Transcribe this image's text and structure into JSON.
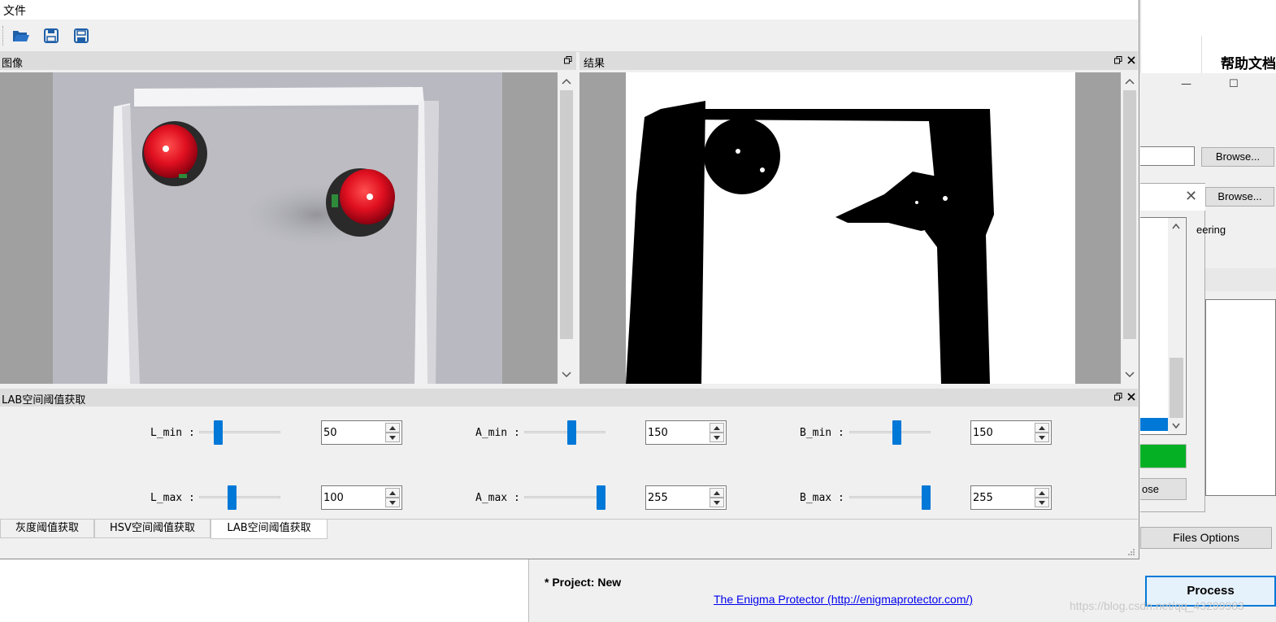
{
  "menu": {
    "file": "文件"
  },
  "toolbar": {
    "open_icon": "folder-open-icon",
    "save_icon": "save-icon",
    "save_as_icon": "save-as-icon"
  },
  "image_dock": {
    "title": "图像"
  },
  "result_dock": {
    "title": "结果"
  },
  "lab_dock": {
    "title": "LAB空间阈值获取"
  },
  "lab_params": {
    "l_min": {
      "label": "L_min :",
      "value": "50",
      "level": 0.2
    },
    "a_min": {
      "label": "A_min :",
      "value": "150",
      "level": 0.59
    },
    "b_min": {
      "label": "B_min :",
      "value": "150",
      "level": 0.59
    },
    "l_max": {
      "label": "L_max :",
      "value": "100",
      "level": 0.39
    },
    "a_max": {
      "label": "A_max :",
      "value": "255",
      "level": 1.0
    },
    "b_max": {
      "label": "B_max :",
      "value": "255",
      "level": 1.0
    }
  },
  "tabs": [
    "灰度阈值获取",
    "HSV空间阈值获取",
    "LAB空间阈值获取"
  ],
  "active_tab": 2,
  "background_app": {
    "help_title": "帮助文档",
    "browse_1": "Browse...",
    "browse_2": "Browse...",
    "steering_text": "eering",
    "close_button": "ose",
    "files_options": "Files Options",
    "process": "Process",
    "project": "* Project: New",
    "link": "The Enigma Protector (http://enigmaprotector.com/)",
    "watermark": "https://blog.csdn.net/qq_43299983"
  },
  "colors": {
    "accent": "#0078d7",
    "green": "#06b025",
    "dock_title": "#dcdcdc"
  }
}
